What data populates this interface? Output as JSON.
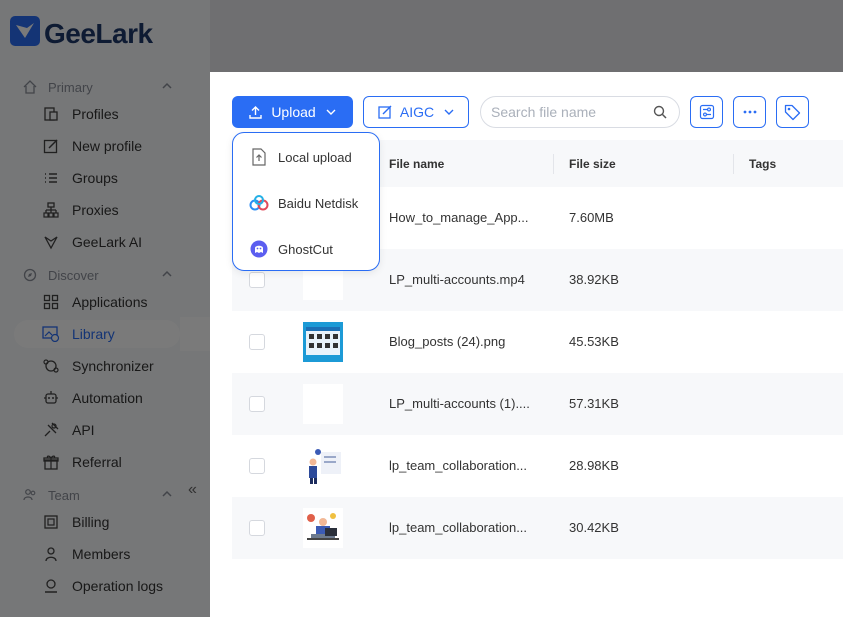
{
  "app": {
    "name": "GeeLark"
  },
  "sidebar": {
    "groups": [
      {
        "label": "Primary",
        "items": [
          {
            "label": "Profiles",
            "icon": "profiles-icon"
          },
          {
            "label": "New profile",
            "icon": "edit-icon"
          },
          {
            "label": "Groups",
            "icon": "list-icon"
          },
          {
            "label": "Proxies",
            "icon": "network-icon"
          },
          {
            "label": "GeeLark AI",
            "icon": "ai-icon"
          }
        ]
      },
      {
        "label": "Discover",
        "items": [
          {
            "label": "Applications",
            "icon": "grid-icon"
          },
          {
            "label": "Library",
            "icon": "image-icon",
            "active": true
          },
          {
            "label": "Synchronizer",
            "icon": "sync-icon"
          },
          {
            "label": "Automation",
            "icon": "robot-icon"
          },
          {
            "label": "API",
            "icon": "api-icon"
          },
          {
            "label": "Referral",
            "icon": "gift-icon"
          }
        ]
      },
      {
        "label": "Team",
        "items": [
          {
            "label": "Billing",
            "icon": "billing-icon"
          },
          {
            "label": "Members",
            "icon": "user-icon"
          },
          {
            "label": "Operation logs",
            "icon": "logs-icon"
          }
        ]
      }
    ]
  },
  "toolbar": {
    "upload_label": "Upload",
    "aigc_label": "AIGC",
    "search_placeholder": "Search file name"
  },
  "upload_menu": [
    {
      "label": "Local upload",
      "icon": "local-upload-icon"
    },
    {
      "label": "Baidu Netdisk",
      "icon": "baidu-netdisk-icon"
    },
    {
      "label": "GhostCut",
      "icon": "ghostcut-icon"
    }
  ],
  "table": {
    "columns": [
      "File name",
      "File size",
      "Tags"
    ],
    "rows": [
      {
        "name": "How_to_manage_App...",
        "size": "7.60MB",
        "thumb": "none"
      },
      {
        "name": "LP_multi-accounts.mp4",
        "size": "38.92KB",
        "thumb": "blank"
      },
      {
        "name": "Blog_posts (24).png",
        "size": "45.53KB",
        "thumb": "blog"
      },
      {
        "name": "LP_multi-accounts (1)....",
        "size": "57.31KB",
        "thumb": "blank"
      },
      {
        "name": "lp_team_collaboration...",
        "size": "28.98KB",
        "thumb": "team1"
      },
      {
        "name": "lp_team_collaboration...",
        "size": "30.42KB",
        "thumb": "team2"
      }
    ]
  },
  "colors": {
    "accent": "#2a6df4",
    "brand": "#1f3a6b"
  }
}
